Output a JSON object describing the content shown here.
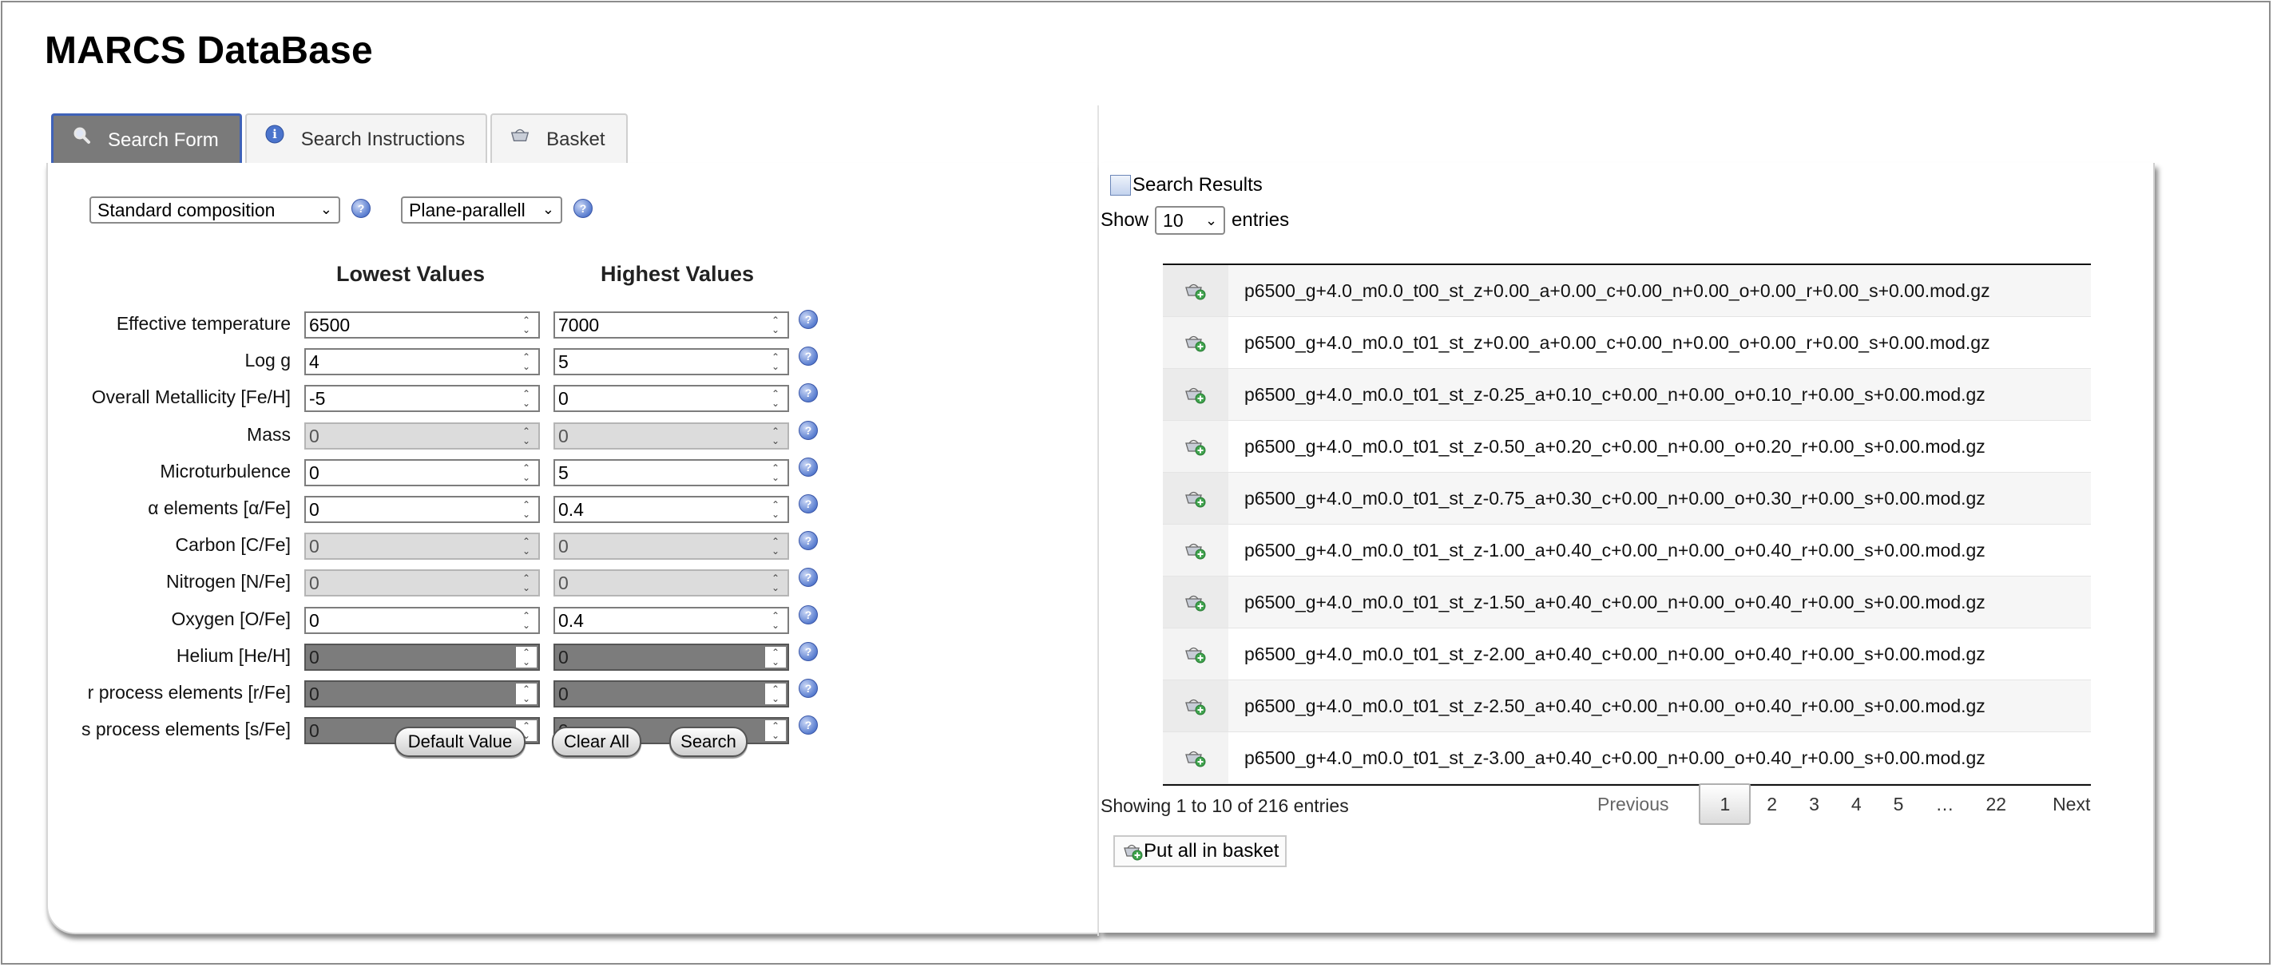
{
  "app_title": "MARCS DataBase",
  "tabs": [
    {
      "label": "Search Form",
      "icon": "search-icon"
    },
    {
      "label": "Search Instructions",
      "icon": "info-icon"
    },
    {
      "label": "Basket",
      "icon": "basket-icon"
    }
  ],
  "form": {
    "composition_select": "Standard composition",
    "geometry_select": "Plane-parallell",
    "lowest_header": "Lowest Values",
    "highest_header": "Highest Values",
    "rows": [
      {
        "label": "Effective temperature",
        "low": "6500",
        "high": "7000",
        "state": "enabled"
      },
      {
        "label": "Log g",
        "low": "4",
        "high": "5",
        "state": "enabled"
      },
      {
        "label": "Overall Metallicity [Fe/H]",
        "low": "-5",
        "high": "0",
        "state": "enabled"
      },
      {
        "label": "Mass",
        "low": "0",
        "high": "0",
        "state": "disabled"
      },
      {
        "label": "Microturbulence",
        "low": "0",
        "high": "5",
        "state": "enabled"
      },
      {
        "label": "α elements [α/Fe]",
        "low": "0",
        "high": "0.4",
        "state": "enabled"
      },
      {
        "label": "Carbon [C/Fe]",
        "low": "0",
        "high": "0",
        "state": "disabled"
      },
      {
        "label": "Nitrogen [N/Fe]",
        "low": "0",
        "high": "0",
        "state": "disabled"
      },
      {
        "label": "Oxygen [O/Fe]",
        "low": "0",
        "high": "0.4",
        "state": "enabled"
      },
      {
        "label": "Helium [He/H]",
        "low": "0",
        "high": "0",
        "state": "locked"
      },
      {
        "label": "r process elements [r/Fe]",
        "low": "0",
        "high": "0",
        "state": "locked"
      },
      {
        "label": "s process elements [s/Fe]",
        "low": "0",
        "high": "0",
        "state": "locked"
      }
    ],
    "buttons": {
      "default": "Default Value",
      "clear": "Clear All",
      "search": "Search"
    }
  },
  "results": {
    "title": "Search Results",
    "show_prefix": "Show",
    "show_value": "10",
    "show_suffix": "entries",
    "files": [
      "p6500_g+4.0_m0.0_t00_st_z+0.00_a+0.00_c+0.00_n+0.00_o+0.00_r+0.00_s+0.00.mod.gz",
      "p6500_g+4.0_m0.0_t01_st_z+0.00_a+0.00_c+0.00_n+0.00_o+0.00_r+0.00_s+0.00.mod.gz",
      "p6500_g+4.0_m0.0_t01_st_z-0.25_a+0.10_c+0.00_n+0.00_o+0.10_r+0.00_s+0.00.mod.gz",
      "p6500_g+4.0_m0.0_t01_st_z-0.50_a+0.20_c+0.00_n+0.00_o+0.20_r+0.00_s+0.00.mod.gz",
      "p6500_g+4.0_m0.0_t01_st_z-0.75_a+0.30_c+0.00_n+0.00_o+0.30_r+0.00_s+0.00.mod.gz",
      "p6500_g+4.0_m0.0_t01_st_z-1.00_a+0.40_c+0.00_n+0.00_o+0.40_r+0.00_s+0.00.mod.gz",
      "p6500_g+4.0_m0.0_t01_st_z-1.50_a+0.40_c+0.00_n+0.00_o+0.40_r+0.00_s+0.00.mod.gz",
      "p6500_g+4.0_m0.0_t01_st_z-2.00_a+0.40_c+0.00_n+0.00_o+0.40_r+0.00_s+0.00.mod.gz",
      "p6500_g+4.0_m0.0_t01_st_z-2.50_a+0.40_c+0.00_n+0.00_o+0.40_r+0.00_s+0.00.mod.gz",
      "p6500_g+4.0_m0.0_t01_st_z-3.00_a+0.40_c+0.00_n+0.00_o+0.40_r+0.00_s+0.00.mod.gz"
    ],
    "showing_text": "Showing 1 to 10 of 216 entries",
    "pager": {
      "previous": "Previous",
      "pages": [
        "1",
        "2",
        "3",
        "4",
        "5",
        "…",
        "22"
      ],
      "current": "1",
      "next": "Next"
    },
    "put_all": "Put all in basket"
  }
}
